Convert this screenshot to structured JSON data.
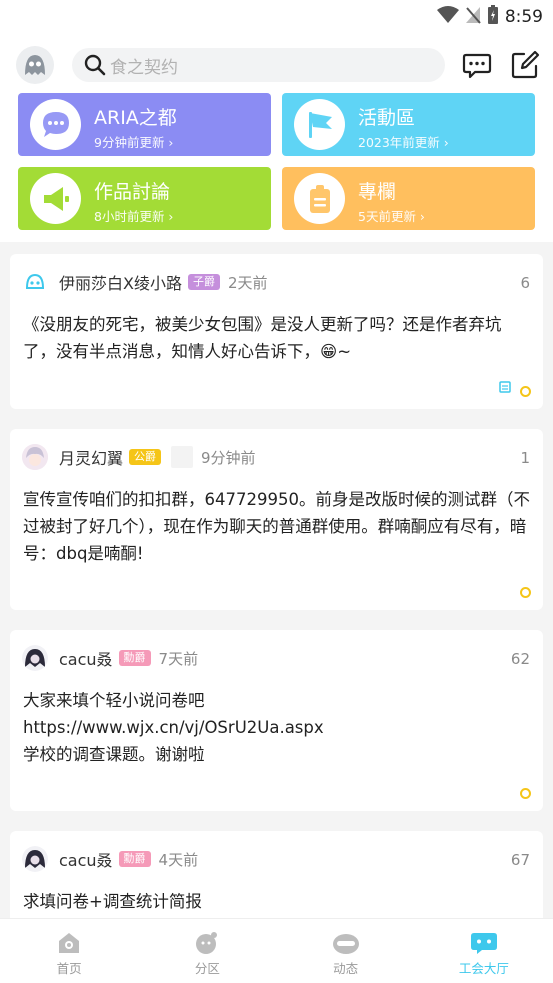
{
  "status": {
    "time": "8:59"
  },
  "header": {
    "search_placeholder": "食之契约"
  },
  "categories": [
    {
      "title": "ARIA之都",
      "subtitle": "9分钟前更新",
      "color": "#8b8cf3"
    },
    {
      "title": "活動區",
      "subtitle": "2023年前更新",
      "color": "#5fd4f5"
    },
    {
      "title": "作品討論",
      "subtitle": "8小时前更新",
      "color": "#a3dc36"
    },
    {
      "title": "專欄",
      "subtitle": "5天前更新",
      "color": "#ffbf5e"
    }
  ],
  "posts": [
    {
      "author": "伊丽莎白X绫小路",
      "badge": "子爵",
      "badge_color": "#c58fdc",
      "time": "2天前",
      "count": "6",
      "text": "《没朋友的死宅，被美少女包围》是没人更新了吗？还是作者弃坑了，没有半点消息，知情人好心告诉下，😁~"
    },
    {
      "author": "月灵幻翼",
      "badge": "公爵",
      "badge_color": "#f5c518",
      "time": "9分钟前",
      "count": "1",
      "text": "宣传宣传咱们的扣扣群，647729950。前身是改版时候的测试群（不过被封了好几个），现在作为聊天的普通群使用。群喃酮应有尽有，暗号：dbq是喃酮!"
    },
    {
      "author": "cacu叒",
      "badge": "勳爵",
      "badge_color": "#f59ab8",
      "time": "7天前",
      "count": "62",
      "text": "大家来填个轻小说问卷吧\nhttps://www.wjx.cn/vj/OSrU2Ua.aspx\n学校的调查课题。谢谢啦"
    },
    {
      "author": "cacu叒",
      "badge": "勳爵",
      "badge_color": "#f59ab8",
      "time": "4天前",
      "count": "67",
      "text": "求填问卷+调查统计简报"
    }
  ],
  "tabs": [
    {
      "label": "首页",
      "icon": "home-icon"
    },
    {
      "label": "分区",
      "icon": "category-icon"
    },
    {
      "label": "动态",
      "icon": "feed-icon"
    },
    {
      "label": "工会大厅",
      "icon": "guild-hall-icon",
      "active": true
    }
  ],
  "colors": {
    "accent": "#3ec8ec",
    "dot": "#f5c518"
  }
}
